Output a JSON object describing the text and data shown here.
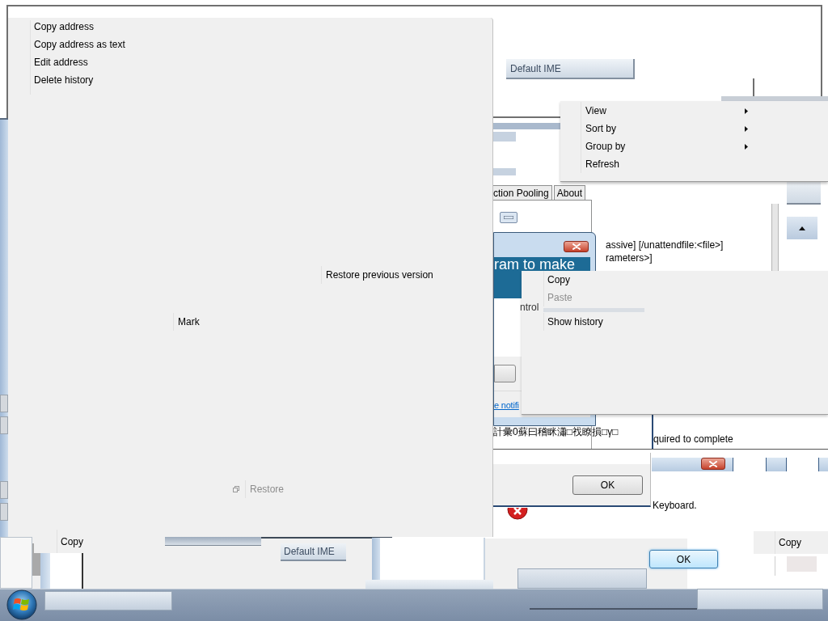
{
  "top_window": {
    "ime_label": "Default IME"
  },
  "address_menu": {
    "items": [
      {
        "label": "Copy address"
      },
      {
        "label": "Copy address as text"
      },
      {
        "label": "Edit address"
      },
      {
        "label": "Delete history"
      }
    ]
  },
  "menu_fragments": [
    {
      "kind": "plain",
      "label": "Restore previous version",
      "disabled": false
    },
    {
      "kind": "plain",
      "label": "Mark",
      "disabled": false
    },
    {
      "kind": "with_icon",
      "label": "Restore",
      "disabled": true
    }
  ],
  "view_menu": {
    "items": [
      {
        "label": "View",
        "submenu": true
      },
      {
        "label": "Sort by",
        "submenu": true
      },
      {
        "label": "Group by",
        "submenu": true
      },
      {
        "label": "Refresh",
        "submenu": false
      }
    ]
  },
  "properties_tabs": [
    {
      "label": "ction Pooling",
      "selected": false
    },
    {
      "label": "About",
      "selected": false
    }
  ],
  "console_lines": [
    "assive] [/unattendfile:<file>]",
    "rameters>]"
  ],
  "uac_dialog": {
    "banner": "ram to make",
    "body": "ntrol",
    "link": "e notifi"
  },
  "edit_menu": {
    "items": [
      {
        "kind": "item",
        "label": "Copy",
        "disabled": false
      },
      {
        "kind": "item",
        "label": "Paste",
        "disabled": true
      },
      {
        "kind": "separator"
      },
      {
        "kind": "item",
        "label": "Show history",
        "disabled": false
      }
    ]
  },
  "garbled_text": "計彙0蘇曰稽眯瀟□䄀瞭損□γ□",
  "install_window": {
    "message": "quired to complete"
  },
  "setup_window": {
    "button": {
      "label": "OK",
      "focused": false
    }
  },
  "error_dialog": {
    "message": "Keyboard.",
    "button": {
      "label": "OK",
      "focused": true
    }
  },
  "copy_popups": [
    {
      "label": "Copy"
    },
    {
      "label": "Copy"
    }
  ],
  "bottom_ime_label": "Default IME"
}
